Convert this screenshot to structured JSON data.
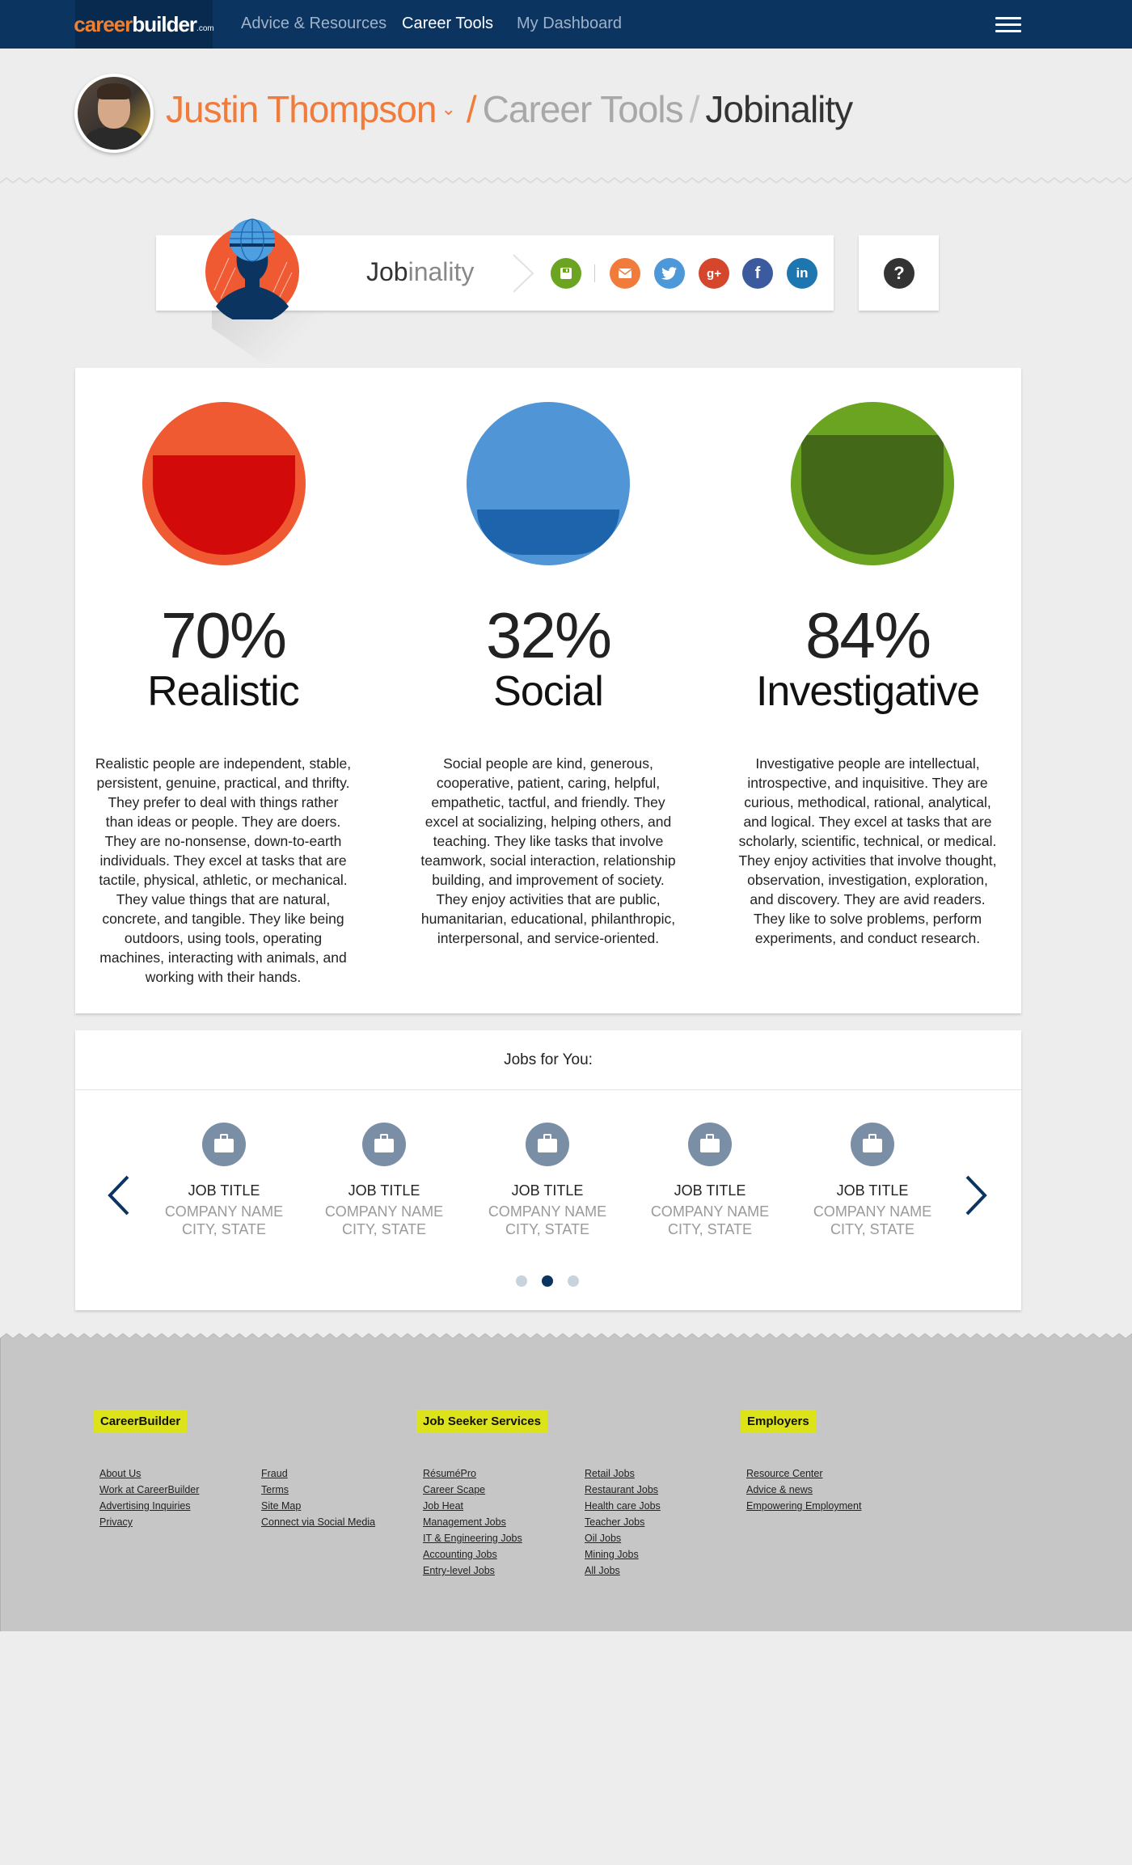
{
  "navbar": {
    "logo_part1": "career",
    "logo_part2": "builder",
    "logo_part3": ".com",
    "links": [
      "Advice & Resources",
      "Career Tools",
      "My Dashboard"
    ],
    "active_link": "Career Tools"
  },
  "breadcrumb": {
    "user": "Justin Thompson",
    "chevron": "⌄",
    "separator": "/",
    "section": "Career Tools",
    "current": "Jobinality"
  },
  "tool": {
    "title_bold": "Job",
    "title_light": "inality",
    "share_buttons": [
      {
        "icon": "save-icon",
        "color": "#6aa421"
      },
      {
        "icon": "email-icon",
        "color": "#f07b3a"
      },
      {
        "icon": "twitter-icon",
        "color": "#4d98d8"
      },
      {
        "icon": "google-plus-icon",
        "color": "#d4472d"
      },
      {
        "icon": "facebook-icon",
        "color": "#3c5a9e"
      },
      {
        "icon": "linkedin-icon",
        "color": "#1e76b0"
      }
    ],
    "help_label": "?"
  },
  "results": [
    {
      "percent_label": "70%",
      "percent": 70,
      "trait": "Realistic",
      "ring_color": "#f05a32",
      "fill_color": "#d20a0a",
      "description": "Realistic people are independent, stable, persistent, genuine, practical, and thrifty. They prefer to deal with things rather than ideas or people. They are doers. They are no-nonsense, down-to-earth individuals. They excel at tasks that are tactile, physical, athletic, or mechanical. They value things that are natural, concrete, and tangible. They like being outdoors, using tools, operating machines, interacting with animals, and working with their hands."
    },
    {
      "percent_label": "32%",
      "percent": 32,
      "trait": "Social",
      "ring_color": "#5096d6",
      "fill_color": "#1d64ad",
      "description": "Social people are kind, generous, cooperative, patient, caring, helpful, empathetic, tactful, and friendly. They excel at socializing, helping others, and teaching. They like tasks that involve teamwork, social interaction, relationship building, and improvement of society. They enjoy activities that are public, humanitarian, educational, philanthropic, interpersonal, and service-oriented."
    },
    {
      "percent_label": "84%",
      "percent": 84,
      "trait": "Investigative",
      "ring_color": "#6aa421",
      "fill_color": "#436818",
      "description": "Investigative people are intellectual, introspective, and inquisitive. They are curious, methodical, rational, analytical, and logical. They excel at tasks that are scholarly, scientific, technical, or medical. They enjoy activities that involve thought, observation, investigation, exploration, and discovery. They are avid readers. They like to solve problems, perform experiments, and conduct research."
    }
  ],
  "jobs": {
    "title": "Jobs for You:",
    "items": [
      {
        "title": "JOB TITLE",
        "company": "COMPANY NAME",
        "location": "CITY, STATE"
      },
      {
        "title": "JOB TITLE",
        "company": "COMPANY NAME",
        "location": "CITY, STATE"
      },
      {
        "title": "JOB TITLE",
        "company": "COMPANY NAME",
        "location": "CITY, STATE"
      },
      {
        "title": "JOB TITLE",
        "company": "COMPANY NAME",
        "location": "CITY, STATE"
      },
      {
        "title": "JOB TITLE",
        "company": "COMPANY NAME",
        "location": "CITY, STATE"
      }
    ],
    "pages": 3,
    "active_page": 2
  },
  "footer": {
    "sections": [
      {
        "heading": "CareerBuilder",
        "columns": [
          [
            "About Us",
            "Work at CareerBuilder",
            "Advertising Inquiries",
            "Privacy"
          ],
          [
            "Fraud",
            "Terms",
            "Site Map",
            "Connect via Social Media"
          ]
        ]
      },
      {
        "heading": "Job Seeker Services",
        "columns": [
          [
            "RésuméPro",
            "Career Scape",
            "Job Heat",
            "Management Jobs",
            "IT & Engineering Jobs",
            "Accounting Jobs",
            "Entry-level Jobs"
          ],
          [
            "Retail Jobs",
            "Restaurant Jobs",
            "Health care Jobs ",
            "Teacher Jobs",
            "Oil Jobs",
            "Mining Jobs",
            "All Jobs"
          ]
        ]
      },
      {
        "heading": "Employers",
        "columns": [
          [
            "Resource Center",
            "Advice & news",
            "Empowering Employment"
          ]
        ]
      }
    ],
    "highlight_color": "#dde31b"
  }
}
